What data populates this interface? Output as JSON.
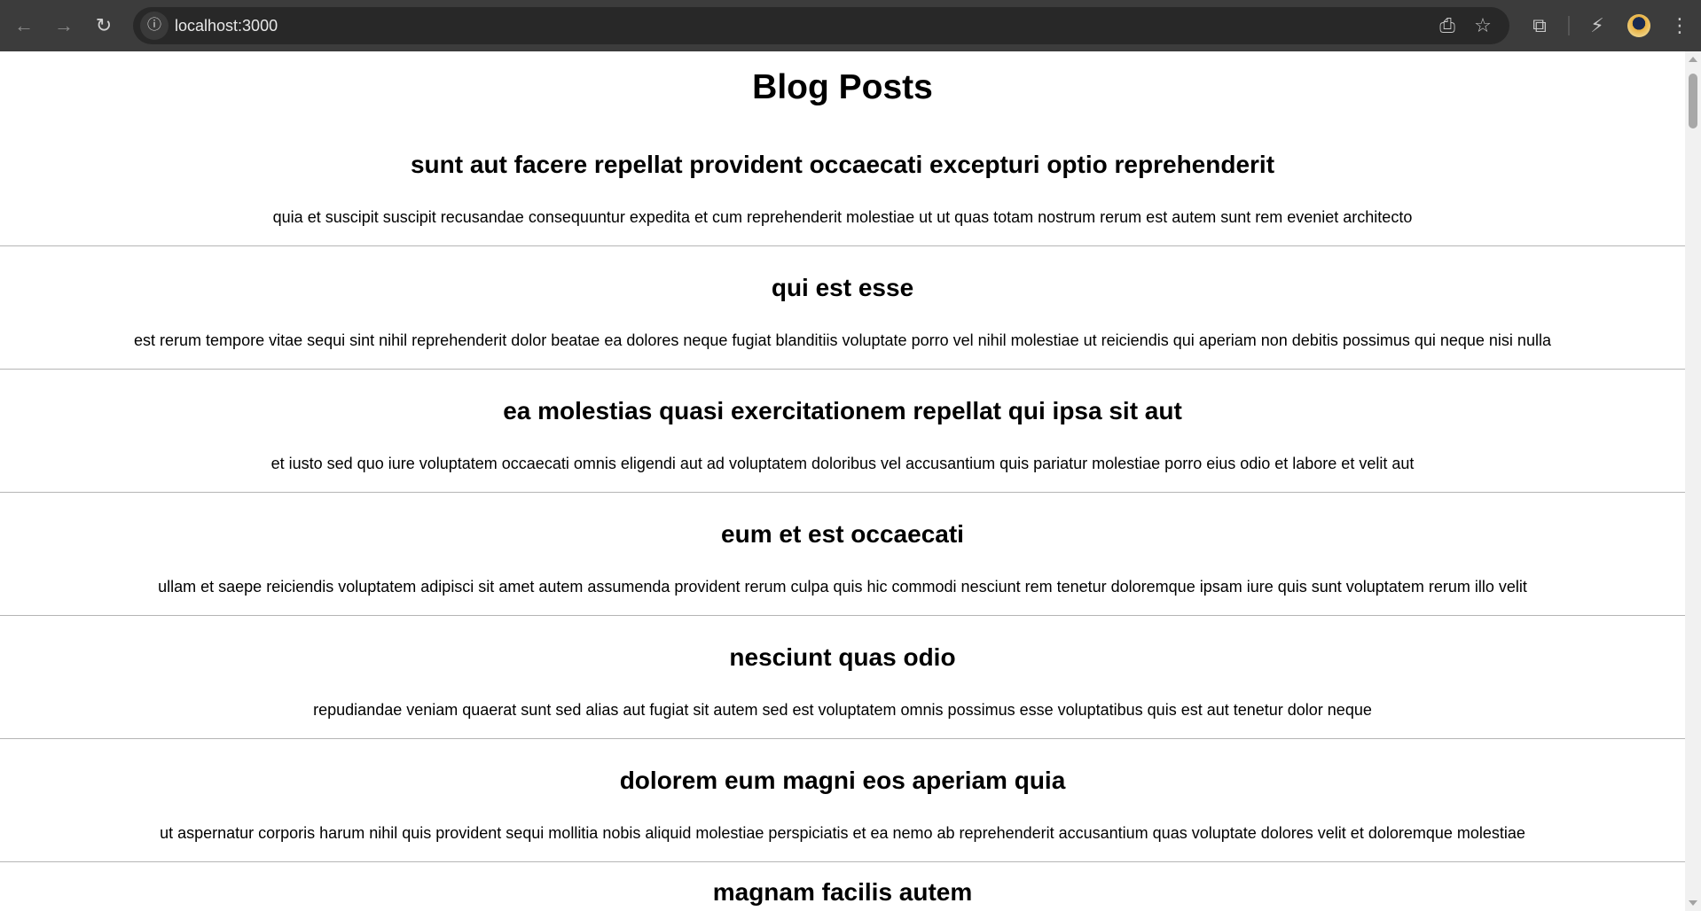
{
  "browser": {
    "url": "localhost:3000"
  },
  "page": {
    "title": "Blog Posts",
    "posts": [
      {
        "title": "sunt aut facere repellat provident occaecati excepturi optio reprehenderit",
        "body": "quia et suscipit suscipit recusandae consequuntur expedita et cum reprehenderit molestiae ut ut quas totam nostrum rerum est autem sunt rem eveniet architecto"
      },
      {
        "title": "qui est esse",
        "body": "est rerum tempore vitae sequi sint nihil reprehenderit dolor beatae ea dolores neque fugiat blanditiis voluptate porro vel nihil molestiae ut reiciendis qui aperiam non debitis possimus qui neque nisi nulla"
      },
      {
        "title": "ea molestias quasi exercitationem repellat qui ipsa sit aut",
        "body": "et iusto sed quo iure voluptatem occaecati omnis eligendi aut ad voluptatem doloribus vel accusantium quis pariatur molestiae porro eius odio et labore et velit aut"
      },
      {
        "title": "eum et est occaecati",
        "body": "ullam et saepe reiciendis voluptatem adipisci sit amet autem assumenda provident rerum culpa quis hic commodi nesciunt rem tenetur doloremque ipsam iure quis sunt voluptatem rerum illo velit"
      },
      {
        "title": "nesciunt quas odio",
        "body": "repudiandae veniam quaerat sunt sed alias aut fugiat sit autem sed est voluptatem omnis possimus esse voluptatibus quis est aut tenetur dolor neque"
      },
      {
        "title": "dolorem eum magni eos aperiam quia",
        "body": "ut aspernatur corporis harum nihil quis provident sequi mollitia nobis aliquid molestiae perspiciatis et ea nemo ab reprehenderit accusantium quas voluptate dolores velit et doloremque molestiae"
      },
      {
        "title": "magnam facilis autem"
      }
    ]
  }
}
